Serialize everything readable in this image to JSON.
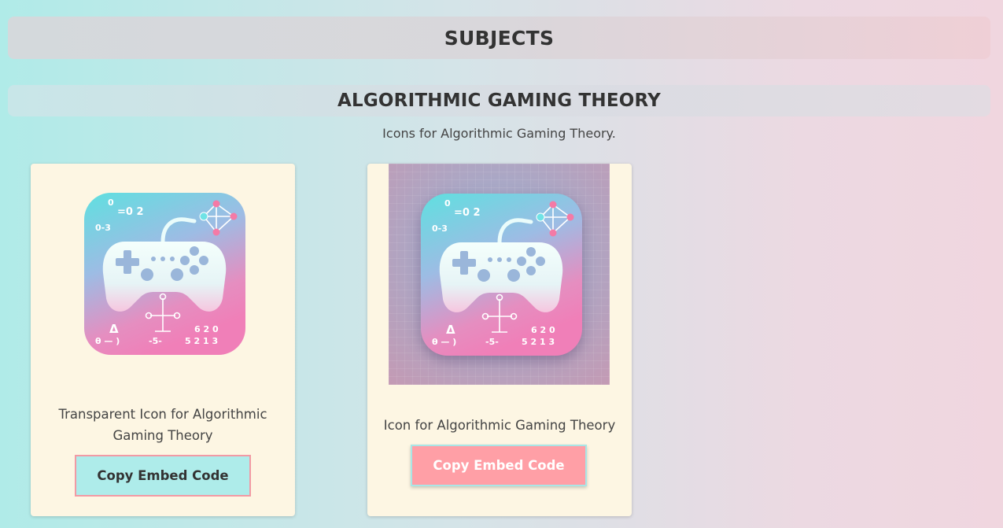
{
  "header": {
    "title": "SUBJECTS"
  },
  "topic": {
    "title": "ALGORITHMIC GAMING THEORY",
    "description": "Icons for Algorithmic Gaming Theory."
  },
  "cards": [
    {
      "caption": "Transparent Icon for Algorithmic Gaming Theory",
      "button_label": "Copy Embed Code",
      "icon": "gamepad-math-icon"
    },
    {
      "caption": "Icon for Algorithmic Gaming Theory",
      "button_label": "Copy Embed Code",
      "icon": "gamepad-math-icon"
    }
  ],
  "icon_art": {
    "formula_top": "=0 2",
    "formula_top_small": "0",
    "formula_left": "0-3",
    "delta": "Δ",
    "formula_bottom_left": "θ — )",
    "formula_bottom_mid": "-5-",
    "formula_bottom_right_top": "6 2 0",
    "formula_bottom_right_bottom": "5 2 1 3"
  },
  "colors": {
    "button_primary_bg": "#aeecea",
    "button_primary_border": "#f29aa4",
    "button_secondary_bg": "#ff9fa6",
    "button_secondary_border": "#a9e6e6",
    "card_bg": "#fdf6e3"
  }
}
